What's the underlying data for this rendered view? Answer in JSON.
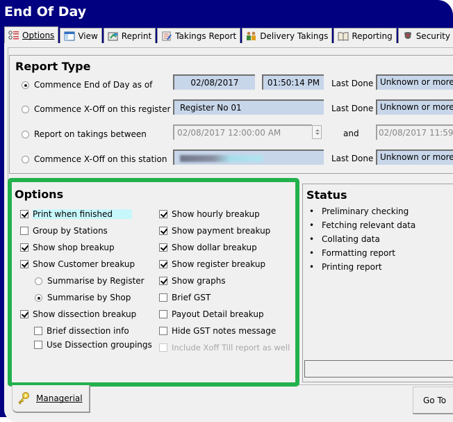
{
  "window": {
    "title": "End Of Day"
  },
  "tabs": [
    {
      "label": "Options",
      "mnemonic": "O",
      "icon": "options-list-icon",
      "active": true
    },
    {
      "label": "View",
      "mnemonic": "V",
      "icon": "window-view-icon",
      "active": false
    },
    {
      "label": "Reprint",
      "mnemonic": "R",
      "icon": "reprint-icon",
      "active": false
    },
    {
      "label": "Takings Report",
      "mnemonic": "T",
      "icon": "takings-report-icon",
      "active": false
    },
    {
      "label": "Delivery Takings",
      "mnemonic": "D",
      "icon": "people-icon",
      "active": false
    },
    {
      "label": "Reporting",
      "mnemonic": "R",
      "icon": "book-icon",
      "active": false
    },
    {
      "label": "Security",
      "mnemonic": "c",
      "icon": "shield-icon",
      "active": false
    }
  ],
  "report_type": {
    "title": "Report Type",
    "options": [
      {
        "label": "Commence End of Day as of",
        "selected": true
      },
      {
        "label": "Commence X-Off on this register",
        "selected": false
      },
      {
        "label": "Report on takings between",
        "selected": false
      },
      {
        "label": "Commence X-Off on this station",
        "selected": false
      }
    ],
    "eod_date": "02/08/2017",
    "eod_time": "01:50:14 PM",
    "register_value": "Register No 01",
    "between_start": "02/08/2017 12:00:00 AM",
    "between_and": "and",
    "between_end": "02/08/2017 11:59",
    "station_value": "",
    "last_done_label": "Last Done",
    "last_done_values": [
      "Unknown or more",
      "Unknown or more",
      "Unknown or more"
    ]
  },
  "options": {
    "title": "Options",
    "left": [
      {
        "label": "Print when finished",
        "checked": true,
        "type": "checkbox",
        "mnemonic": "P",
        "highlighted": true
      },
      {
        "label": "Group by Stations",
        "checked": false,
        "type": "checkbox",
        "mnemonic": "G"
      },
      {
        "label": "Show shop breakup",
        "checked": true,
        "type": "checkbox"
      },
      {
        "label": "Show Customer breakup",
        "checked": true,
        "type": "checkbox"
      },
      {
        "label": "Summarise by Register",
        "checked": false,
        "type": "radio"
      },
      {
        "label": "Summarise by Shop",
        "checked": true,
        "type": "radio"
      },
      {
        "label": "Show dissection breakup",
        "checked": true,
        "type": "checkbox"
      },
      {
        "label": "Brief dissection info",
        "checked": false,
        "type": "checkbox"
      },
      {
        "label": "Use Dissection groupings",
        "checked": false,
        "type": "checkbox"
      }
    ],
    "right": [
      {
        "label": "Show hourly breakup",
        "checked": true
      },
      {
        "label": "Show payment breakup",
        "checked": true
      },
      {
        "label": "Show dollar breakup",
        "checked": true
      },
      {
        "label": "Show register breakup",
        "checked": true
      },
      {
        "label": "Show graphs",
        "checked": true
      },
      {
        "label": "Brief GST",
        "checked": false
      },
      {
        "label": "Payout Detail breakup",
        "checked": false
      },
      {
        "label": "Hide GST notes message",
        "checked": false
      },
      {
        "label": "Include Xoff Till report as well",
        "checked": false,
        "disabled": true
      }
    ],
    "highlight_color": "#c6f7fb",
    "border_color": "#22b14c"
  },
  "status": {
    "title": "Status",
    "items": [
      "Preliminary checking",
      "Fetching relevant data",
      "Collating data",
      "Formatting report",
      "Printing report"
    ]
  },
  "buttons": {
    "managerial": "Managerial",
    "goto": "Go To"
  }
}
